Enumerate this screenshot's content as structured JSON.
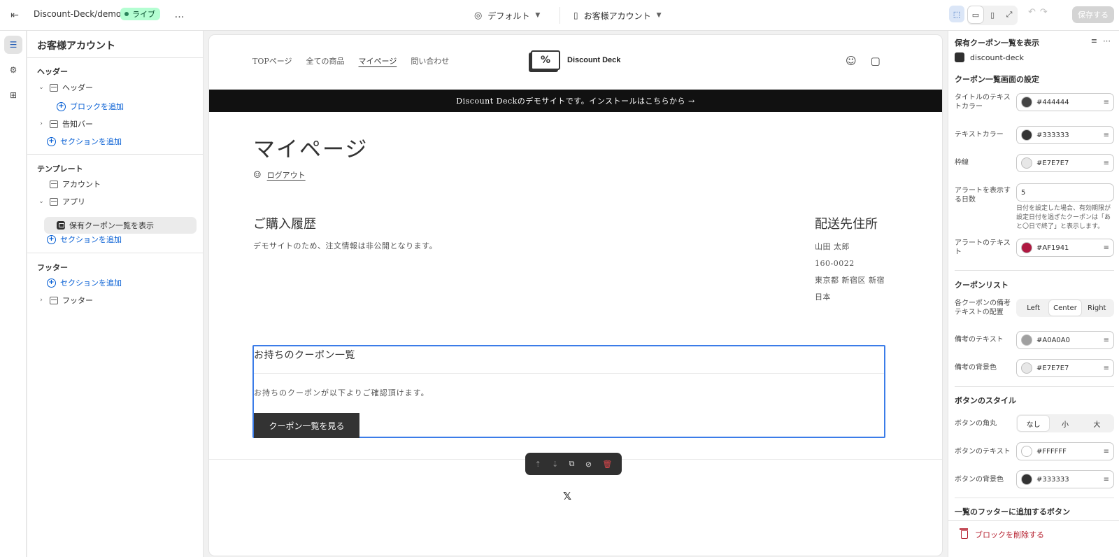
{
  "topbar": {
    "store_path": "Discount-Deck/demo",
    "live_label": "ライブ",
    "more_icon": "…",
    "theme_label": "デフォルト",
    "template_label": "お客様アカウント",
    "save_label": "保存する"
  },
  "tree": {
    "title": "お客様アカウント",
    "header_group": "ヘッダー",
    "header_item": "ヘッダー",
    "add_block": "ブロックを追加",
    "announce_item": "告知バー",
    "add_section": "セクションを追加",
    "template_group": "テンプレート",
    "account_item": "アカウント",
    "app_item": "アプリ",
    "app_block": "保有クーポン一覧を表示",
    "footer_group": "フッター",
    "footer_item": "フッター"
  },
  "preview": {
    "nav": [
      "TOPページ",
      "全ての商品",
      "マイページ",
      "問い合わせ"
    ],
    "logo_symbol": "%",
    "logo_name": "Discount Deck",
    "announcement": "Discount Deckのデモサイトです。インストールはこちらから →",
    "page_title": "マイページ",
    "logout": "ログアウト",
    "orders_title": "ご購入履歴",
    "orders_note": "デモサイトのため、注文情報は非公開となります。",
    "address_title": "配送先住所",
    "address_lines": [
      "山田 太郎",
      "160-0022",
      "東京都 新宿区 新宿",
      "日本"
    ],
    "coupon_title": "お持ちのクーポン一覧",
    "coupon_desc": "お持ちのクーポンが以下よりご確認頂けます。",
    "coupon_button": "クーポン一覧を見る",
    "social_icon": "𝕏"
  },
  "settings": {
    "title": "保有クーポン一覧を表示",
    "app_name": "discount-deck",
    "sec_list_screen": "クーポン一覧画面の設定",
    "title_color_label": "タイトルのテキストカラー",
    "title_color": "#444444",
    "text_color_label": "テキストカラー",
    "text_color": "#333333",
    "border_label": "枠線",
    "border_color": "#E7E7E7",
    "alert_days_label": "アラートを表示する日数",
    "alert_days": "5",
    "alert_help": "日付を設定した場合、有効期限が設定日付を過ぎたクーポンは「あと〇日で終了」と表示します。",
    "alert_text_label": "アラートのテキスト",
    "alert_text_color": "#AF1941",
    "sec_coupon_list": "クーポンリスト",
    "align_label": "各クーポンの備考テキストの配置",
    "align_options": [
      "Left",
      "Center",
      "Right"
    ],
    "align_selected": "Center",
    "note_text_label": "備考のテキスト",
    "note_text_color": "#A0A0A0",
    "note_bg_label": "備考の背景色",
    "note_bg_color": "#E7E7E7",
    "sec_button_style": "ボタンのスタイル",
    "radius_label": "ボタンの角丸",
    "radius_options": [
      "なし",
      "小",
      "大"
    ],
    "radius_selected": "なし",
    "btn_text_label": "ボタンのテキスト",
    "btn_text_color": "#FFFFFF",
    "btn_bg_label": "ボタンの背景色",
    "btn_bg_color": "#333333",
    "sec_footer_button": "一覧のフッターに追加するボタン",
    "delete_block": "ブロックを削除する"
  },
  "colors": {
    "accent": "#005bd3",
    "selection_outline": "#3b7ce8",
    "live_badge_bg": "#b4fed2",
    "danger": "#b51e2d"
  }
}
